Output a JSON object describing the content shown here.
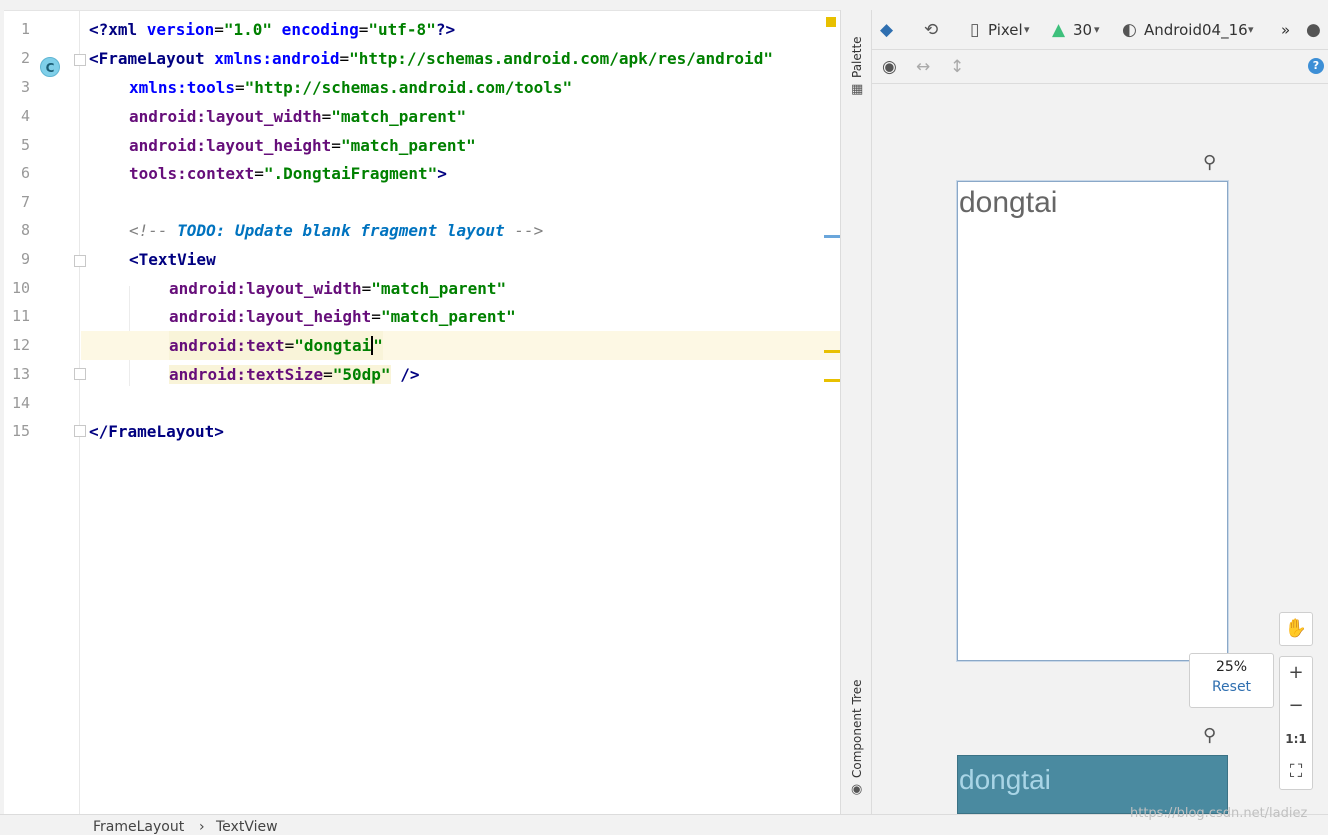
{
  "editor": {
    "lines": [
      {
        "n": "1"
      },
      {
        "n": "2"
      },
      {
        "n": "3"
      },
      {
        "n": "4"
      },
      {
        "n": "5"
      },
      {
        "n": "6"
      },
      {
        "n": "7"
      },
      {
        "n": "8"
      },
      {
        "n": "9"
      },
      {
        "n": "10"
      },
      {
        "n": "11"
      },
      {
        "n": "12"
      },
      {
        "n": "13"
      },
      {
        "n": "14"
      },
      {
        "n": "15"
      }
    ],
    "code": {
      "l1": {
        "a": "<?xml ",
        "b": "version",
        "c": "=",
        "d": "\"1.0\"",
        "e": " encoding",
        "f": "=",
        "g": "\"utf-8\"",
        "h": "?>"
      },
      "l2": {
        "a": "<FrameLayout ",
        "b": "xmlns:android",
        "c": "=",
        "d": "\"http://schemas.android.com/apk/res/android\""
      },
      "l3": {
        "a": "xmlns:tools",
        "b": "=",
        "c": "\"http://schemas.android.com/tools\""
      },
      "l4": {
        "a": "android:layout_width",
        "b": "=",
        "c": "\"match_parent\""
      },
      "l5": {
        "a": "android:layout_height",
        "b": "=",
        "c": "\"match_parent\""
      },
      "l6": {
        "a": "tools:context",
        "b": "=",
        "c": "\".DongtaiFragment\"",
        "d": ">"
      },
      "l8": {
        "a": "<!-- ",
        "b": "TODO: Update blank fragment layout",
        "c": " -->"
      },
      "l9": {
        "a": "<TextView"
      },
      "l10": {
        "a": "android:layout_width",
        "b": "=",
        "c": "\"match_parent\""
      },
      "l11": {
        "a": "android:layout_height",
        "b": "=",
        "c": "\"match_parent\""
      },
      "l12": {
        "a": "android:text",
        "b": "=",
        "c": "\"dongtai",
        "d": "\""
      },
      "l13": {
        "a": "android:textSize",
        "b": "=",
        "c": "\"50dp\"",
        "d": " />"
      },
      "l15": {
        "a": "</FrameLayout>"
      }
    },
    "class_badge": "C"
  },
  "side_strip": {
    "palette_label": "Palette",
    "component_tree_label": "Component Tree"
  },
  "toolbar": {
    "device": "Pixel",
    "api": "30",
    "theme": "Android04_16",
    "overflow": "»",
    "help": "?"
  },
  "preview": {
    "text": "dongtai",
    "text2": "dongtai"
  },
  "zoom": {
    "percent": "25%",
    "reset": "Reset",
    "one_to_one": "1:1"
  },
  "breadcrumb": {
    "item1": "FrameLayout",
    "sep": "›",
    "item2": "TextView"
  },
  "watermark": "https://blog.csdn.net/ladiez",
  "colors": {
    "accent": "#2f6fb0",
    "preview_bg": "#4a8aa0",
    "current_line": "#fdf8e4"
  }
}
